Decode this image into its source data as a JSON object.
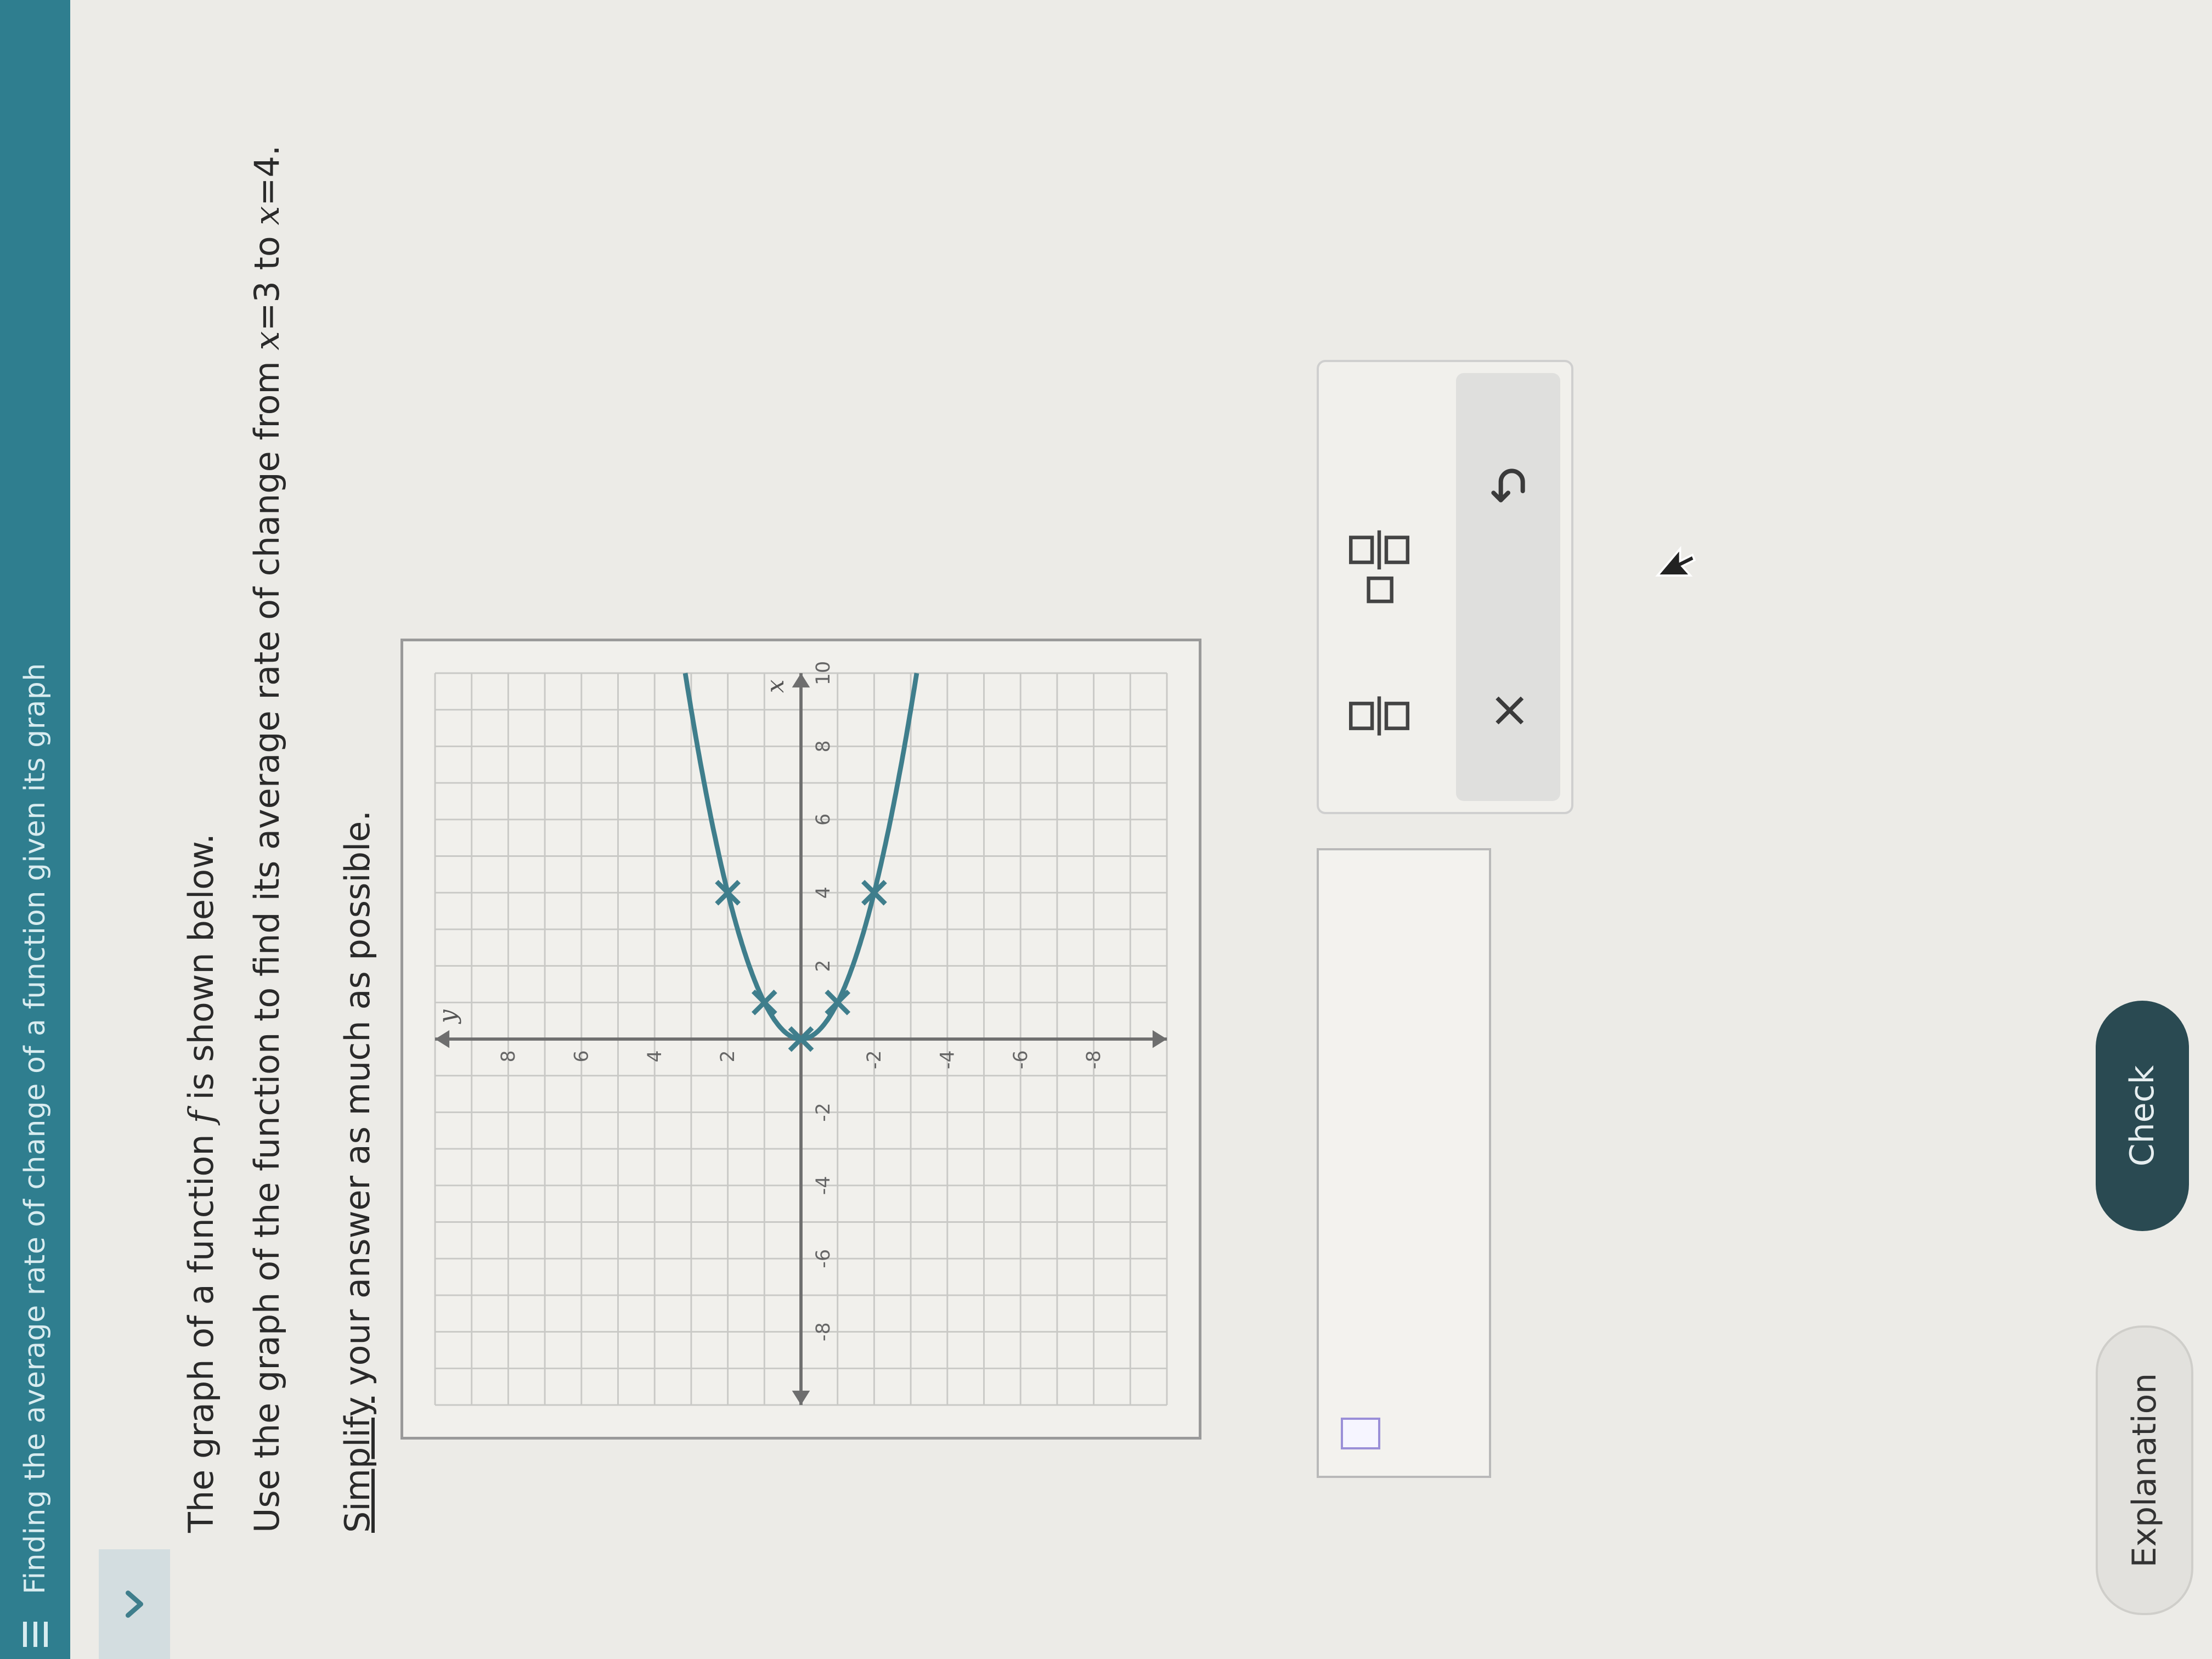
{
  "header": {
    "title": "Finding the average rate of change of a function given its graph"
  },
  "icons": {
    "menu": "hamburger-menu-icon",
    "collapse": "chevron-down-icon",
    "undo": "undo-icon",
    "clear": "close-icon",
    "cursor": "mouse-pointer-icon"
  },
  "problem": {
    "line1_pre": "The graph of a function ",
    "line1_var": "f",
    "line1_post": " is shown below.",
    "line2_pre": "Use the graph of the function to find its average rate of change from ",
    "line2_x1": "x",
    "line2_eq1": "=3 to ",
    "line2_x2": "x",
    "line2_eq2": "=4.",
    "line3_link": "Simplify",
    "line3_rest": " your answer as much as possible."
  },
  "chart_data": {
    "type": "line",
    "xlabel": "x",
    "ylabel": "y",
    "xlim": [
      -10,
      10
    ],
    "ylim": [
      -10,
      10
    ],
    "x_ticks": [
      -8,
      -6,
      -4,
      -2,
      2,
      4,
      6,
      8,
      10
    ],
    "y_ticks": [
      -8,
      -6,
      -4,
      -2,
      2,
      4,
      6,
      8
    ],
    "grid": true,
    "series": [
      {
        "points": [
          [
            0,
            0
          ],
          [
            1,
            -1
          ],
          [
            1,
            1
          ],
          [
            4,
            -2
          ],
          [
            4,
            2
          ]
        ],
        "curve": "x = y^2"
      }
    ],
    "colors": {
      "curve": "#3f7e8c",
      "grid": "#c9c9c6",
      "axes": "#6e6e6e"
    }
  },
  "answer": {
    "value": ""
  },
  "keypad": {
    "clear_label": "×"
  },
  "buttons": {
    "explanation": "Explanation",
    "check": "Check"
  }
}
